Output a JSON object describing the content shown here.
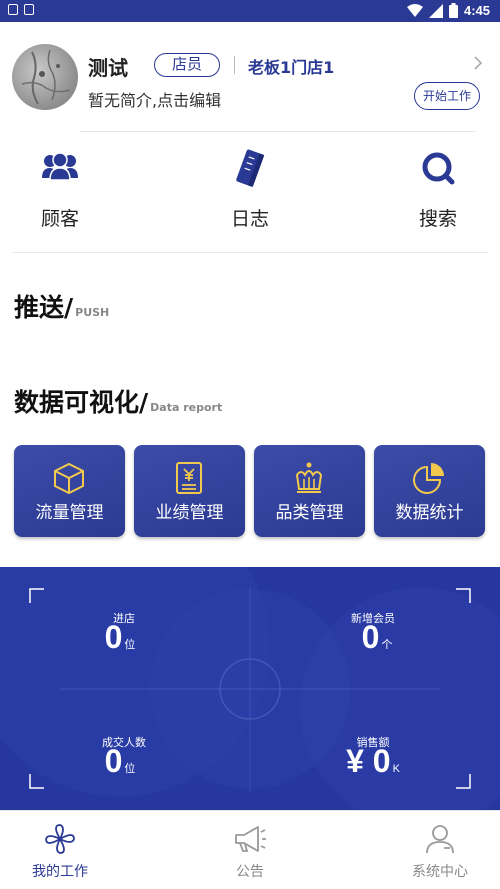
{
  "status_bar": {
    "time": "4:45"
  },
  "profile": {
    "name": "测试",
    "role": "店员",
    "store": "老板1门店1",
    "bio": "暂无简介,点击编辑",
    "start_button": "开始工作"
  },
  "quick_actions": [
    {
      "label": "顾客",
      "icon": "customers-icon"
    },
    {
      "label": "日志",
      "icon": "log-icon"
    },
    {
      "label": "搜索",
      "icon": "search-icon"
    }
  ],
  "sections": {
    "push": {
      "title": "推送/",
      "subtitle": "PUSH"
    },
    "data_report": {
      "title": "数据可视化/",
      "subtitle": "Data report"
    }
  },
  "tiles": [
    {
      "label": "流量管理",
      "icon": "box-icon"
    },
    {
      "label": "业绩管理",
      "icon": "yen-document-icon"
    },
    {
      "label": "品类管理",
      "icon": "crown-icon"
    },
    {
      "label": "数据统计",
      "icon": "pie-chart-icon"
    }
  ],
  "dashboard": {
    "visitors": {
      "label": "进店",
      "value": "0",
      "unit": "位"
    },
    "new_members": {
      "label": "新增会员",
      "value": "0",
      "unit": "个"
    },
    "deals": {
      "label": "成交人数",
      "value": "0",
      "unit": "位"
    },
    "sales": {
      "label": "销售额",
      "value": "¥ 0",
      "unit": "K"
    }
  },
  "bottom_nav": [
    {
      "label": "我的工作",
      "active": true
    },
    {
      "label": "公告",
      "active": false
    },
    {
      "label": "系统中心",
      "active": false
    }
  ],
  "colors": {
    "primary": "#2a3a94",
    "dashboard_bg": "#2637a0"
  }
}
